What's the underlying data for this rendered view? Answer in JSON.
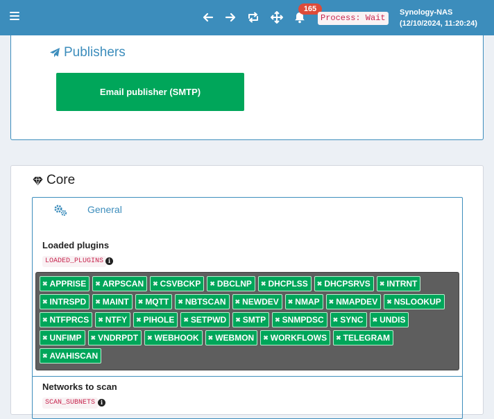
{
  "header": {
    "notification_count": "165",
    "process_status": "Process: Wait",
    "server_name": "Synology-NAS",
    "server_time": "(12/10/2024, 11:20:24)"
  },
  "publishers": {
    "title": "Publishers",
    "email_button_label": "Email publisher (SMTP)"
  },
  "core": {
    "title": "Core",
    "tab_general_label": "General",
    "loaded_plugins": {
      "label": "Loaded plugins",
      "code": "LOADED_PLUGINS",
      "values": [
        "APPRISE",
        "ARPSCAN",
        "CSVBCKP",
        "DBCLNP",
        "DHCPLSS",
        "DHCPSRVS",
        "INTRNT",
        "INTRSPD",
        "MAINT",
        "MQTT",
        "NBTSCAN",
        "NEWDEV",
        "NMAP",
        "NMAPDEV",
        "NSLOOKUP",
        "NTFPRCS",
        "NTFY",
        "PIHOLE",
        "SETPWD",
        "SMTP",
        "SNMPDSC",
        "SYNC",
        "UNDIS",
        "UNFIMP",
        "VNDRPDT",
        "WEBHOOK",
        "WEBMON",
        "WORKFLOWS",
        "TELEGRAM",
        "AVAHISCAN"
      ]
    },
    "networks_to_scan": {
      "label": "Networks to scan",
      "code": "SCAN_SUBNETS"
    }
  },
  "colors": {
    "header": "#3c8dbc",
    "success": "#00a65a",
    "badge": "#dd4b39",
    "code_text": "#c7254e"
  },
  "icons": {
    "menu": "hamburger-icon",
    "back": "arrow-left-icon",
    "forward": "arrow-right-icon",
    "reload": "retweet-icon",
    "move": "arrows-move-icon",
    "notifications": "bell-icon",
    "publishers": "paper-plane-icon",
    "core": "gem-icon",
    "general_tab": "cogs-icon",
    "info": "info-circle-icon",
    "chip_remove": "close-icon"
  }
}
